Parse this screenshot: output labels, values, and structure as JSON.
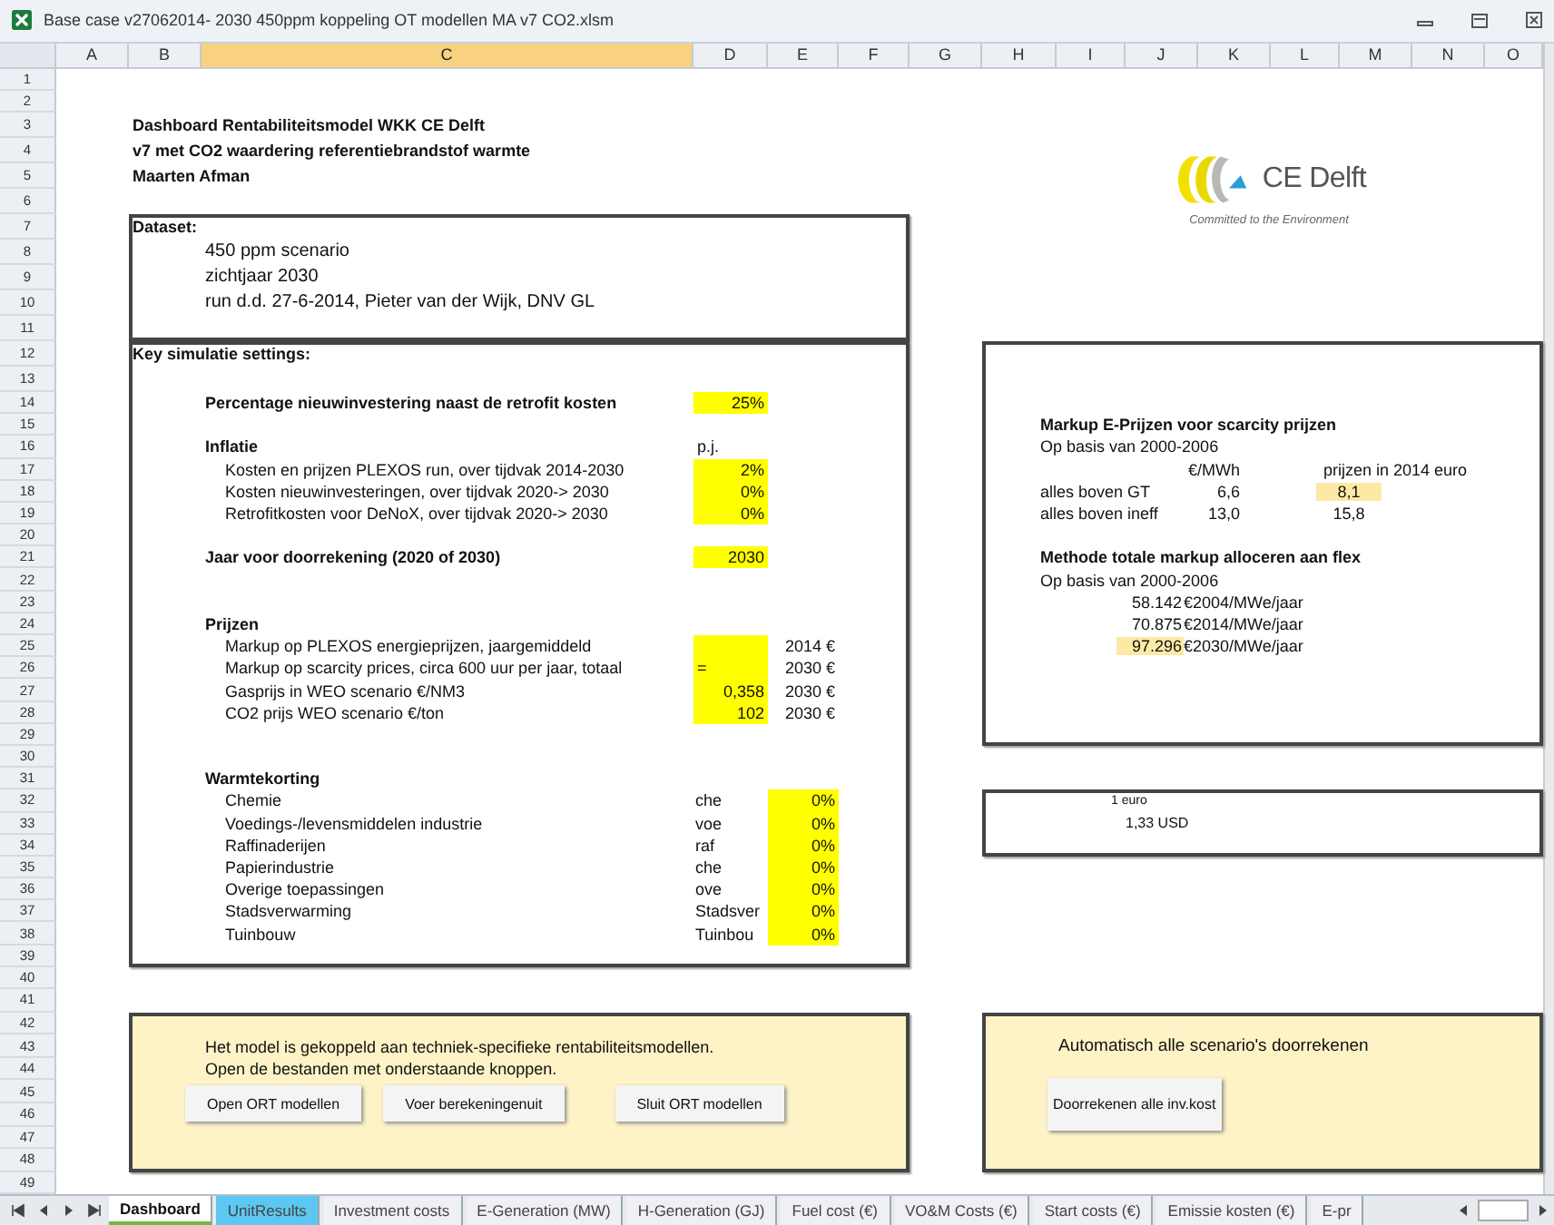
{
  "window": {
    "title": "Base case v27062014- 2030 450ppm koppeling OT modellen MA v7 CO2.xlsm"
  },
  "column_headers": [
    {
      "label": "A",
      "selected": false
    },
    {
      "label": "B",
      "selected": false
    },
    {
      "label": "C",
      "selected": true
    },
    {
      "label": "D",
      "selected": false
    },
    {
      "label": "E",
      "selected": false
    },
    {
      "label": "F",
      "selected": false
    },
    {
      "label": "G",
      "selected": false
    },
    {
      "label": "H",
      "selected": false
    },
    {
      "label": "I",
      "selected": false
    },
    {
      "label": "J",
      "selected": false
    },
    {
      "label": "K",
      "selected": false
    },
    {
      "label": "L",
      "selected": false
    },
    {
      "label": "M",
      "selected": false
    },
    {
      "label": "N",
      "selected": false
    },
    {
      "label": "O",
      "selected": false
    }
  ],
  "row_numbers": [
    "1",
    "2",
    "3",
    "4",
    "5",
    "6",
    "7",
    "8",
    "9",
    "10",
    "11",
    "12",
    "13",
    "14",
    "15",
    "16",
    "17",
    "18",
    "19",
    "20",
    "21",
    "22",
    "23",
    "24",
    "25",
    "26",
    "27",
    "28",
    "29",
    "30",
    "31",
    "32",
    "33",
    "34",
    "35",
    "36",
    "37",
    "38",
    "39",
    "40",
    "41",
    "42",
    "43",
    "44",
    "45",
    "46",
    "47",
    "48",
    "49"
  ],
  "heading": [
    "Dashboard Rentabiliteitsmodel WKK CE Delft",
    "v7 met CO2 waardering referentiebrandstof warmte",
    "Maarten Afman"
  ],
  "dataset": {
    "title": "Dataset:",
    "lines": [
      "450 ppm scenario",
      "zichtjaar 2030",
      "run d.d. 27-6-2014, Pieter van der Wijk, DNV GL"
    ]
  },
  "key_settings": {
    "title": "Key simulatie settings:",
    "percentage": {
      "label": "Percentage nieuwinvestering naast de retrofit kosten",
      "value": "25%"
    },
    "inflatie": {
      "title": "Inflatie",
      "unit": "p.j.",
      "items": [
        {
          "label": "Kosten en prijzen PLEXOS run, over tijdvak 2014-2030",
          "value": "2%"
        },
        {
          "label": "Kosten nieuwinvesteringen, over tijdvak 2020-> 2030",
          "value": "0%"
        },
        {
          "label": "Retrofitkosten voor DeNoX, over tijdvak 2020-> 2030",
          "value": "0%"
        }
      ]
    },
    "jaar": {
      "label": "Jaar voor doorrekening (2020 of 2030)",
      "value": "2030"
    },
    "prijzen": {
      "title": "Prijzen",
      "items": [
        {
          "label": "Markup op PLEXOS energieprijzen, jaargemiddeld",
          "unit": "2014 €"
        },
        {
          "label": "Markup op scarcity prices, circa 600 uur per jaar, totaal",
          "value": "=",
          "unit": "2030 €"
        },
        {
          "label": "Gasprijs in WEO scenario €/NM3",
          "value": "0,358",
          "unit": "2030 €"
        },
        {
          "label": "CO2 prijs WEO scenario €/ton",
          "value": "102",
          "unit": "2030 €"
        }
      ]
    },
    "warmtekorting": {
      "title": "Warmtekorting",
      "items": [
        {
          "label": "Chemie",
          "code": "che",
          "value": "0%"
        },
        {
          "label": "Voedings-/levensmiddelen industrie",
          "code": "voe",
          "value": "0%"
        },
        {
          "label": "Raffinaderijen",
          "code": "raf",
          "value": "0%"
        },
        {
          "label": "Papierindustrie",
          "code": "che",
          "value": "0%"
        },
        {
          "label": "Overige toepassingen",
          "code": "ove",
          "value": "0%"
        },
        {
          "label": "Stadsverwarming",
          "code": "Stadsver",
          "value": "0%"
        },
        {
          "label": "Tuinbouw",
          "code": "Tuinbou",
          "value": "0%"
        }
      ]
    }
  },
  "logo": {
    "name": "CE Delft",
    "tagline": "Committed to the Environment"
  },
  "scarcity": {
    "title": "Markup E-Prijzen voor scarcity prijzen",
    "subtitle": "Op basis van 2000-2006",
    "unit": "€/MWh",
    "unit_2014": "prijzen in 2014 euro",
    "rows": [
      {
        "label": "alles boven GT",
        "value": "6,6",
        "value_2014": "8,1",
        "highlighted": true
      },
      {
        "label": "alles boven ineff",
        "value": "13,0",
        "value_2014": "15,8",
        "highlighted": false
      }
    ],
    "method_title": "Methode totale markup alloceren aan flex",
    "method_subtitle": "Op basis van 2000-2006",
    "method_rows": [
      {
        "value": "58.142",
        "unit": "€2004/MWe/jaar",
        "highlighted": false
      },
      {
        "value": "70.875",
        "unit": "€2014/MWe/jaar",
        "highlighted": false
      },
      {
        "value": "97.296",
        "unit": "€2030/MWe/jaar",
        "highlighted": true
      }
    ]
  },
  "exchange": {
    "label": "1 euro",
    "value": "1,33 USD"
  },
  "model_panel": {
    "lines": [
      "Het model is gekoppeld aan techniek-specifieke rentabiliteitsmodellen.",
      "Open de bestanden met onderstaande knoppen."
    ],
    "buttons": [
      "Open ORT modellen",
      "Voer berekeningenuit",
      "Sluit ORT modellen"
    ]
  },
  "auto_panel": {
    "title": "Automatisch alle scenario's doorrekenen",
    "button": "Doorrekenen alle inv.kost"
  },
  "sheet_tabs": [
    {
      "label": "Dashboard",
      "selected": true
    },
    {
      "label": "UnitResults",
      "selected": false,
      "color": "#5cc8f2"
    },
    {
      "label": "Investment costs",
      "selected": false
    },
    {
      "label": "E-Generation (MW)",
      "selected": false
    },
    {
      "label": "H-Generation (GJ)",
      "selected": false
    },
    {
      "label": "Fuel cost (€)",
      "selected": false
    },
    {
      "label": "VO&M Costs (€)",
      "selected": false
    },
    {
      "label": "Start costs (€)",
      "selected": false
    },
    {
      "label": "Emissie kosten (€)",
      "selected": false
    },
    {
      "label": "E-pr",
      "selected": false
    }
  ]
}
